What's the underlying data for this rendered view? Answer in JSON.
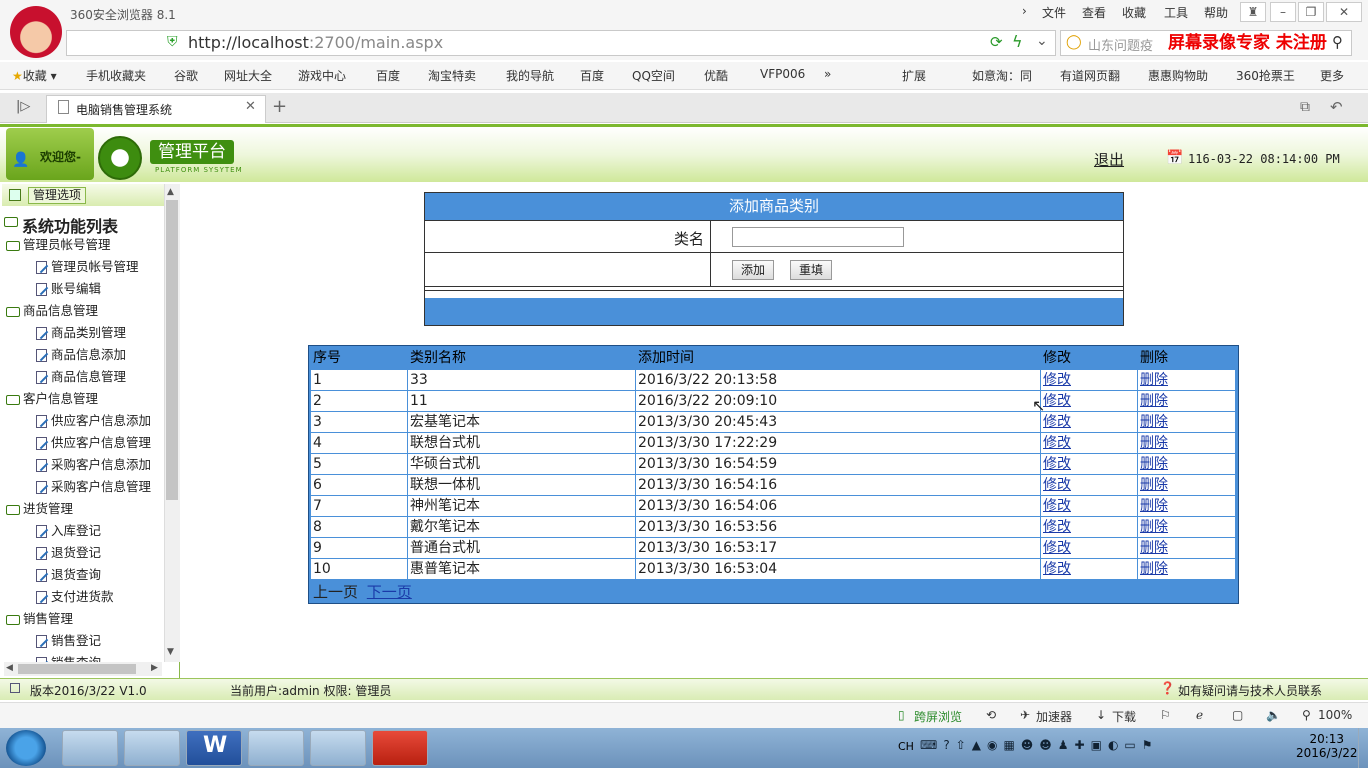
{
  "browser": {
    "title": "360安全浏览器 8.1",
    "menus": [
      "文件",
      "查看",
      "收藏",
      "工具",
      "帮助"
    ],
    "url_host": "http://localhost",
    "url_rest": ":2700/main.aspx",
    "search_placeholder": "山东问题疫",
    "watermark": "屏幕录像专家  未注册",
    "bookmarks": [
      "收藏",
      "手机收藏夹",
      "谷歌",
      "网址大全",
      "游戏中心",
      "百度",
      "淘宝特卖",
      "我的导航",
      "百度",
      "QQ空间",
      "优酷",
      "VFP006",
      "扩展",
      "如意淘：同",
      "有道网页翻",
      "惠惠购物助",
      "360抢票王",
      "更多"
    ],
    "tab_title": "电脑销售管理系统",
    "status_items": [
      "跨屏浏览",
      "加速器",
      "下载",
      "100%"
    ]
  },
  "app": {
    "welcome": "欢迎您-",
    "logo_text": "管理平台",
    "logo_sub": "PLATFORM SYSYTEM",
    "logout": "退出",
    "datetime": "116-03-22 08:14:00 PM",
    "sidebar_header": "管理选项",
    "sidebar_title": "系统功能列表",
    "sidebar": [
      {
        "type": "group",
        "label": "管理员帐号管理"
      },
      {
        "type": "item",
        "label": "管理员帐号管理"
      },
      {
        "type": "item",
        "label": "账号编辑"
      },
      {
        "type": "group",
        "label": "商品信息管理"
      },
      {
        "type": "item",
        "label": "商品类别管理"
      },
      {
        "type": "item",
        "label": "商品信息添加"
      },
      {
        "type": "item",
        "label": "商品信息管理"
      },
      {
        "type": "group",
        "label": "客户信息管理"
      },
      {
        "type": "item",
        "label": "供应客户信息添加"
      },
      {
        "type": "item",
        "label": "供应客户信息管理"
      },
      {
        "type": "item",
        "label": "采购客户信息添加"
      },
      {
        "type": "item",
        "label": "采购客户信息管理"
      },
      {
        "type": "group",
        "label": "进货管理"
      },
      {
        "type": "item",
        "label": "入库登记"
      },
      {
        "type": "item",
        "label": "退货登记"
      },
      {
        "type": "item",
        "label": "退货查询"
      },
      {
        "type": "item",
        "label": "支付进货款"
      },
      {
        "type": "group",
        "label": "销售管理"
      },
      {
        "type": "item",
        "label": "销售登记"
      },
      {
        "type": "item",
        "label": "销售查询"
      }
    ],
    "form": {
      "title": "添加商品类别",
      "label_name": "类名",
      "name_value": "",
      "add_btn": "添加",
      "reset_btn": "重填"
    },
    "table": {
      "headers": [
        "序号",
        "类别名称",
        "添加时间",
        "修改",
        "删除"
      ],
      "rows": [
        [
          "1",
          "33",
          "2016/3/22 20:13:58",
          "修改",
          "删除"
        ],
        [
          "2",
          "11",
          "2016/3/22 20:09:10",
          "修改",
          "删除"
        ],
        [
          "3",
          "宏基笔记本",
          "2013/3/30 20:45:43",
          "修改",
          "删除"
        ],
        [
          "4",
          "联想台式机",
          "2013/3/30 17:22:29",
          "修改",
          "删除"
        ],
        [
          "5",
          "华硕台式机",
          "2013/3/30 16:54:59",
          "修改",
          "删除"
        ],
        [
          "6",
          "联想一体机",
          "2013/3/30 16:54:16",
          "修改",
          "删除"
        ],
        [
          "7",
          "神州笔记本",
          "2013/3/30 16:54:06",
          "修改",
          "删除"
        ],
        [
          "8",
          "戴尔笔记本",
          "2013/3/30 16:53:56",
          "修改",
          "删除"
        ],
        [
          "9",
          "普通台式机",
          "2013/3/30 16:53:17",
          "修改",
          "删除"
        ],
        [
          "10",
          "惠普笔记本",
          "2013/3/30 16:53:04",
          "修改",
          "删除"
        ]
      ],
      "prev": "上一页",
      "next": "下一页"
    },
    "status": {
      "version": "版本2016/3/22 V1.0",
      "user": "当前用户:admin 权限: 管理员",
      "help": "如有疑问请与技术人员联系"
    }
  },
  "taskbar": {
    "tray_lang": "CH",
    "time": "20:13",
    "date": "2016/3/22"
  }
}
